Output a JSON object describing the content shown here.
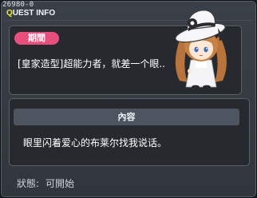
{
  "header": {
    "quest_id": "26980-0",
    "title_prefix": "Q",
    "title_rest": "UEST INFO"
  },
  "period": {
    "badge_label": "期間",
    "text": "[皇家造型]超能力者，就差一个眼.."
  },
  "content": {
    "header_label": "內容",
    "text": "眼里闪着爱心的布莱尔找我说话。"
  },
  "status": {
    "label": "狀態:",
    "value": "可開始"
  },
  "colors": {
    "badge": "#e84f7c",
    "title_accent": "#e9ee3a",
    "panel_bg": "#262a2f"
  },
  "icons": {
    "npc": "npc-portrait-girl-white-hat"
  }
}
